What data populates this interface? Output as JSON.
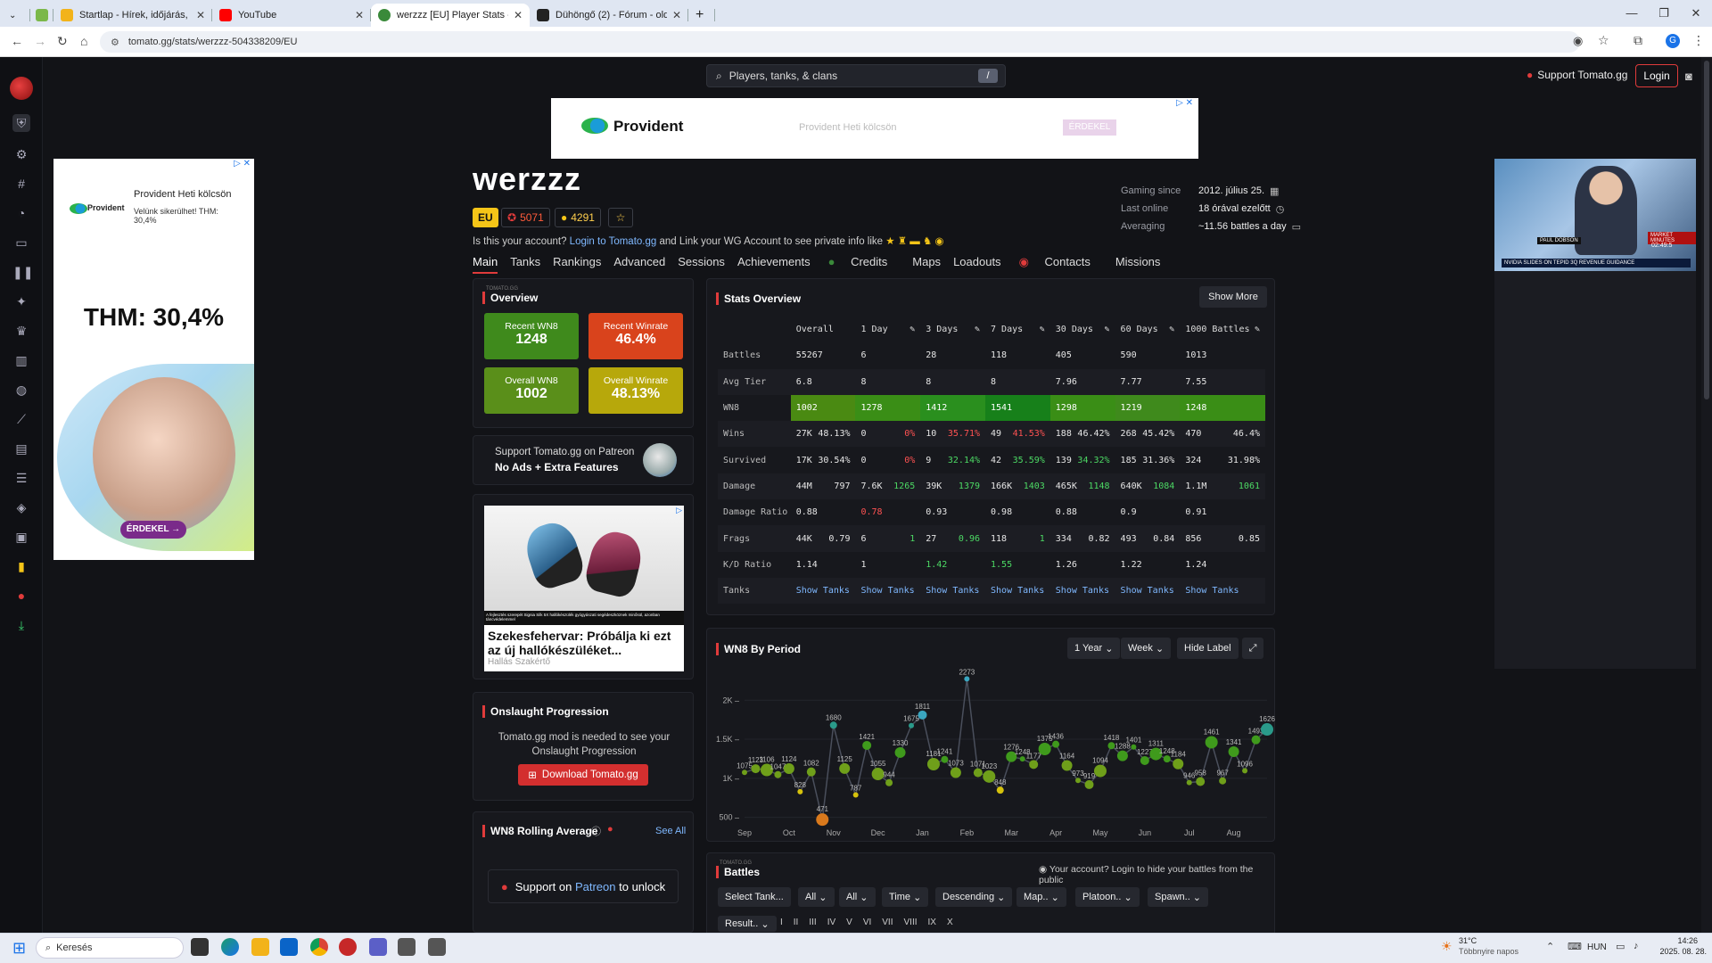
{
  "browser": {
    "tabs": [
      {
        "title": "Startlap - Hírek, időjárás, infor",
        "color": "#f2b31a",
        "active": false
      },
      {
        "title": "YouTube",
        "color": "#ff0000",
        "active": false
      },
      {
        "title": "werzzz [EU] Player Stats - Toma",
        "color": "#3a8a3a",
        "active": true
      },
      {
        "title": "Dühöngő (2) - Fórum - oldal: 1",
        "color": "#222222",
        "active": false
      }
    ],
    "url": "tomato.gg/stats/werzzz-504338209/EU",
    "new_tab": "+"
  },
  "header": {
    "search_placeholder": "Players, tanks, & clans",
    "search_key": "/",
    "support": "Support Tomato.gg",
    "login": "Login"
  },
  "ads": {
    "top": {
      "brand": "Provident",
      "text": "Provident Heti kölcsön",
      "cta": "ÉRDEKEL"
    },
    "left": {
      "brand": "Provident",
      "title": "Provident Heti kölcsön",
      "sub": "Velünk sikerülhet! THM: 30,4%",
      "big": "THM: 30,4%",
      "cta": "ÉRDEKEL →"
    },
    "video": {
      "name": "PAUL DOBSON",
      "ticker": "NVIDIA SLIDES ON TEPID 3Q REVENUE GUIDANCE",
      "time": "02:49:5",
      "tag": "MARKET MINUTES"
    }
  },
  "player": {
    "name": "werzzz",
    "region": "EU",
    "badge1": "5071",
    "badge2": "4291",
    "claim_pre": "Is this your account? ",
    "claim_link": "Login to Tomato.gg",
    "claim_post": " and Link your WG Account to see private info like",
    "tabs": [
      "Main",
      "Tanks",
      "Rankings",
      "Advanced",
      "Sessions",
      "Achievements",
      "Credits",
      "Maps",
      "Loadouts",
      "Contacts",
      "Missions"
    ],
    "gaming_since_label": "Gaming since",
    "gaming_since": "2012. július 25.",
    "last_online_label": "Last online",
    "last_online": "18 órával ezelőtt",
    "averaging_label": "Averaging",
    "averaging": "~11.56 battles a day"
  },
  "overview": {
    "kicker": "TOMATO.GG",
    "title": "Overview",
    "boxes": [
      {
        "label": "Recent WN8",
        "value": "1248",
        "color": "#3f8a1c"
      },
      {
        "label": "Recent Winrate",
        "value": "46.4%",
        "color": "#d9431c"
      },
      {
        "label": "Overall WN8",
        "value": "1002",
        "color": "#5a8f1a"
      },
      {
        "label": "Overall Winrate",
        "value": "48.13%",
        "color": "#b7a80b"
      }
    ]
  },
  "patreon": {
    "line1": "Support Tomato.gg on Patreon",
    "line2": "No Ads + Extra Features"
  },
  "ad_mid": {
    "title": "Szekesfehervar: Próbálja ki ezt az új hallókészüléket...",
    "source": "Hallás Szakértő",
    "caption": "A fejlesztés szerepét Signia Silk 5X hallókészülék gyógyászati segédeszköznek minősül, azonban táncvédelemmel"
  },
  "onslaught": {
    "title": "Onslaught Progression",
    "text": "Tomato.gg mod is needed to see your Onslaught Progression",
    "button": "Download Tomato.gg"
  },
  "rolling": {
    "title": "WN8 Rolling Average",
    "see_all": "See All",
    "unlock_pre": "Support on ",
    "unlock_link": "Patreon",
    "unlock_post": " to unlock"
  },
  "stats": {
    "title": "Stats Overview",
    "show_more": "Show More",
    "columns": [
      "Overall",
      "1 Day",
      "3 Days",
      "7 Days",
      "30 Days",
      "60 Days",
      "1000 Battles"
    ],
    "rows": [
      {
        "label": "Battles",
        "cells": [
          [
            "55267",
            ""
          ],
          [
            "6",
            ""
          ],
          [
            "28",
            ""
          ],
          [
            "118",
            ""
          ],
          [
            "405",
            ""
          ],
          [
            "590",
            ""
          ],
          [
            "1013",
            ""
          ]
        ]
      },
      {
        "label": "Avg Tier",
        "cells": [
          [
            "6.8",
            ""
          ],
          [
            "8",
            ""
          ],
          [
            "8",
            ""
          ],
          [
            "8",
            ""
          ],
          [
            "7.96",
            ""
          ],
          [
            "7.77",
            ""
          ],
          [
            "7.55",
            ""
          ]
        ]
      },
      {
        "label": "WN8",
        "cells": [
          [
            "1002",
            ""
          ],
          [
            "1278",
            ""
          ],
          [
            "1412",
            ""
          ],
          [
            "1541",
            ""
          ],
          [
            "1298",
            ""
          ],
          [
            "1219",
            ""
          ],
          [
            "1248",
            ""
          ]
        ],
        "colors": [
          "#4a8a12",
          "#3a8e16",
          "#2a8f1e",
          "#17801a",
          "#3a8e16",
          "#3f8a1c",
          "#3a8e16"
        ]
      },
      {
        "label": "Wins",
        "cells": [
          [
            "27K",
            "48.13%"
          ],
          [
            "0",
            "0%"
          ],
          [
            "10",
            "35.71%"
          ],
          [
            "49",
            "41.53%"
          ],
          [
            "188",
            "46.42%"
          ],
          [
            "268",
            "45.42%"
          ],
          [
            "470",
            "46.4%"
          ]
        ],
        "tone": [
          "",
          "red",
          "red",
          "red",
          "",
          "",
          ""
        ]
      },
      {
        "label": "Survived",
        "cells": [
          [
            "17K",
            "30.54%"
          ],
          [
            "0",
            "0%"
          ],
          [
            "9",
            "32.14%"
          ],
          [
            "42",
            "35.59%"
          ],
          [
            "139",
            "34.32%"
          ],
          [
            "185",
            "31.36%"
          ],
          [
            "324",
            "31.98%"
          ]
        ],
        "tone": [
          "",
          "red",
          "grn",
          "grn",
          "grn",
          "",
          ""
        ]
      },
      {
        "label": "Damage",
        "cells": [
          [
            "44M",
            "797"
          ],
          [
            "7.6K",
            "1265"
          ],
          [
            "39K",
            "1379"
          ],
          [
            "166K",
            "1403"
          ],
          [
            "465K",
            "1148"
          ],
          [
            "640K",
            "1084"
          ],
          [
            "1.1M",
            "1061"
          ]
        ],
        "tone": [
          "",
          "grn",
          "grn",
          "grn",
          "grn",
          "grn",
          "grn"
        ]
      },
      {
        "label": "Damage Ratio",
        "cells": [
          [
            "0.88",
            ""
          ],
          [
            "0.78",
            ""
          ],
          [
            "0.93",
            ""
          ],
          [
            "0.98",
            ""
          ],
          [
            "0.88",
            ""
          ],
          [
            "0.9",
            ""
          ],
          [
            "0.91",
            ""
          ]
        ],
        "tone0": [
          "",
          "red",
          "",
          "",
          "",
          "",
          ""
        ]
      },
      {
        "label": "Frags",
        "cells": [
          [
            "44K",
            "0.79"
          ],
          [
            "6",
            "1"
          ],
          [
            "27",
            "0.96"
          ],
          [
            "118",
            "1"
          ],
          [
            "334",
            "0.82"
          ],
          [
            "493",
            "0.84"
          ],
          [
            "856",
            "0.85"
          ]
        ],
        "tone": [
          "",
          "grn",
          "grn",
          "grn",
          "",
          "",
          ""
        ]
      },
      {
        "label": "K/D Ratio",
        "cells": [
          [
            "1.14",
            ""
          ],
          [
            "1",
            ""
          ],
          [
            "1.42",
            ""
          ],
          [
            "1.55",
            ""
          ],
          [
            "1.26",
            ""
          ],
          [
            "1.22",
            ""
          ],
          [
            "1.24",
            ""
          ]
        ],
        "tone0": [
          "",
          "",
          "grn",
          "grn",
          "",
          "",
          ""
        ]
      },
      {
        "label": "Tanks",
        "cells": [
          [
            "Show Tanks",
            ""
          ],
          [
            "Show Tanks",
            ""
          ],
          [
            "Show Tanks",
            ""
          ],
          [
            "Show Tanks",
            ""
          ],
          [
            "Show Tanks",
            ""
          ],
          [
            "Show Tanks",
            ""
          ],
          [
            "Show Tanks",
            ""
          ]
        ],
        "tone0": [
          "blue",
          "blue",
          "blue",
          "blue",
          "blue",
          "blue",
          "blue"
        ]
      }
    ]
  },
  "wn8_chart": {
    "title": "WN8 By Period",
    "range": "1 Year",
    "granularity": "Week",
    "hide_label": "Hide Label"
  },
  "chart_data": {
    "type": "line",
    "title": "WN8 By Period",
    "xlabel": "",
    "ylabel": "",
    "x_ticks": [
      "Sep",
      "Oct",
      "Nov",
      "Dec",
      "Jan",
      "Feb",
      "Mar",
      "Apr",
      "May",
      "Jun",
      "Jul",
      "Aug"
    ],
    "y_ticks": [
      "500",
      "1K",
      "1.5K",
      "2K"
    ],
    "ylim": [
      450,
      2300
    ],
    "x": [
      0,
      0.25,
      0.5,
      0.75,
      1,
      1.25,
      1.5,
      1.75,
      2,
      2.25,
      2.5,
      2.75,
      3,
      3.25,
      3.5,
      3.75,
      4,
      4.25,
      4.5,
      4.75,
      5,
      5.25,
      5.5,
      5.75,
      6,
      6.25,
      6.5,
      6.75,
      7,
      7.25,
      7.5,
      7.75,
      8,
      8.25,
      8.5,
      8.75,
      9,
      9.25,
      9.5,
      9.75,
      10,
      10.25,
      10.5,
      10.75,
      11,
      11.25,
      11.5,
      11.75
    ],
    "values": [
      1075,
      1123,
      1106,
      1047,
      1124,
      828,
      1082,
      471,
      1680,
      1125,
      787,
      1421,
      1055,
      944,
      1330,
      1675,
      1811,
      1181,
      1241,
      1073,
      2273,
      1071,
      1023,
      848,
      1276,
      1248,
      1177,
      1375,
      1436,
      1164,
      973,
      919,
      1094,
      1418,
      1288,
      1401,
      1227,
      1311,
      1248,
      1184,
      946,
      958,
      1461,
      967,
      1341,
      1096,
      1493,
      1626
    ],
    "grid": true
  },
  "battles": {
    "kicker": "TOMATO.GG",
    "title": "Battles",
    "hide_note": "Your account? Login to hide your battles from the public",
    "filters": [
      "Select Tank...",
      "All",
      "All",
      "Time",
      "Descending",
      "Map..",
      "Platoon..",
      "Spawn.."
    ],
    "result": "Result..",
    "tiers": [
      "I",
      "II",
      "III",
      "IV",
      "V",
      "VI",
      "VII",
      "VIII",
      "IX",
      "X"
    ]
  },
  "taskbar": {
    "search": "Keresés",
    "temp": "31°C",
    "weather": "Többnyire napos",
    "lang": "HUN",
    "time": "14:26",
    "date": "2025. 08. 28."
  }
}
